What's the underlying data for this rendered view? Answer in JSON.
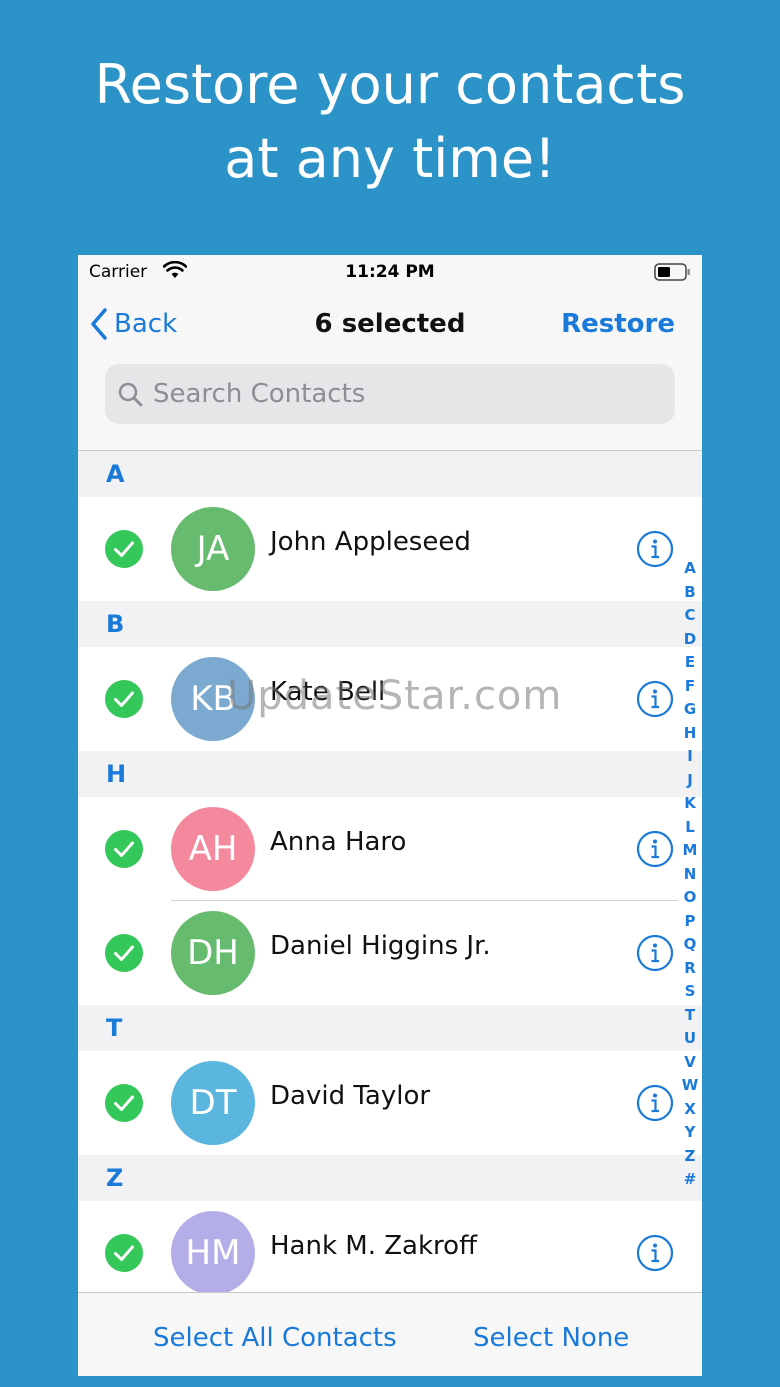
{
  "headline": {
    "line1": "Restore your contacts",
    "line2": "at any time!"
  },
  "status_bar": {
    "carrier": "Carrier",
    "time": "11:24 PM"
  },
  "navbar": {
    "back_label": "Back",
    "title": "6 selected",
    "restore_label": "Restore"
  },
  "search": {
    "placeholder": "Search Contacts",
    "value": ""
  },
  "sections": [
    {
      "letter": "A",
      "contacts": [
        {
          "initials": "JA",
          "name": "John Appleseed",
          "color": "#66bb6e",
          "selected": true
        }
      ]
    },
    {
      "letter": "B",
      "contacts": [
        {
          "initials": "KB",
          "name": "Kate Bell",
          "color": "#7ba9cf",
          "selected": true
        }
      ]
    },
    {
      "letter": "H",
      "contacts": [
        {
          "initials": "AH",
          "name": "Anna Haro",
          "color": "#f4889c",
          "selected": true
        },
        {
          "initials": "DH",
          "name": "Daniel Higgins Jr.",
          "color": "#66bb6e",
          "selected": true
        }
      ]
    },
    {
      "letter": "T",
      "contacts": [
        {
          "initials": "DT",
          "name": "David Taylor",
          "color": "#5ab6de",
          "selected": true
        }
      ]
    },
    {
      "letter": "Z",
      "contacts": [
        {
          "initials": "HM",
          "name": "Hank M. Zakroff",
          "color": "#b3aee8",
          "selected": true
        }
      ]
    }
  ],
  "index_letters": [
    "A",
    "B",
    "C",
    "D",
    "E",
    "F",
    "G",
    "H",
    "I",
    "J",
    "K",
    "L",
    "M",
    "N",
    "O",
    "P",
    "Q",
    "R",
    "S",
    "T",
    "U",
    "V",
    "W",
    "X",
    "Y",
    "Z",
    "#"
  ],
  "toolbar": {
    "select_all_label": "Select All Contacts",
    "select_none_label": "Select None"
  },
  "watermark": "UpdateStar.com",
  "colors": {
    "background": "#2b93c8",
    "accent": "#1a7ad9",
    "check_green": "#34c759"
  }
}
